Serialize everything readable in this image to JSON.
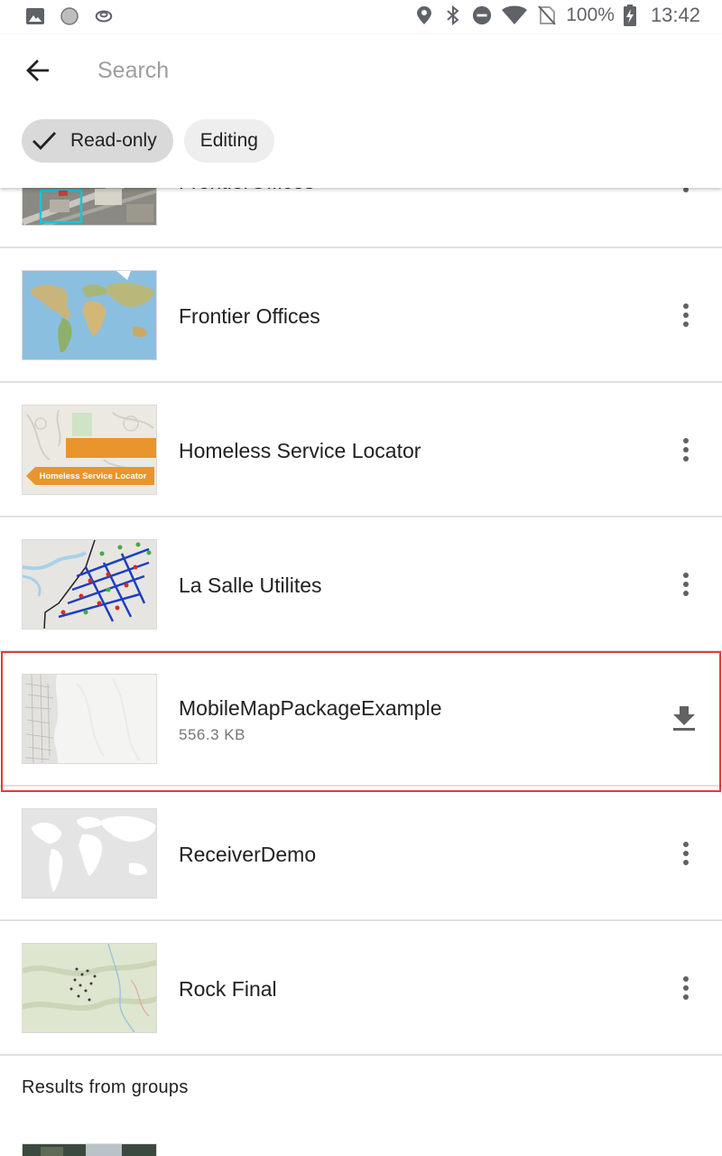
{
  "status_bar": {
    "left_icons": [
      "image-icon",
      "circle-icon",
      "sync-icon"
    ],
    "right_icons": [
      "location-icon",
      "bluetooth-icon",
      "do-not-disturb-icon",
      "wifi-icon",
      "no-sim-icon"
    ],
    "battery_text": "100%",
    "time": "13:42"
  },
  "header": {
    "search_placeholder": "Search",
    "search_value": "",
    "chips": [
      {
        "label": "Read-only",
        "selected": true
      },
      {
        "label": "Editing",
        "selected": false
      }
    ]
  },
  "items": [
    {
      "title": "FrontierOffices",
      "action": "more-vert-icon"
    },
    {
      "title": "Frontier Offices",
      "action": "more-vert-icon"
    },
    {
      "title": "Homeless Service Locator",
      "thumb_text": "Homeless Service Locator",
      "action": "more-vert-icon"
    },
    {
      "title": "La Salle Utilites",
      "action": "more-vert-icon"
    },
    {
      "title": "MobileMapPackageExample",
      "subtitle": "556.3 KB",
      "action": "download-icon",
      "highlighted": true
    },
    {
      "title": "ReceiverDemo",
      "action": "more-vert-icon"
    },
    {
      "title": "Rock Final",
      "action": "more-vert-icon"
    }
  ],
  "section": {
    "groups_header": "Results from groups"
  },
  "colors": {
    "highlight": "#e53935",
    "chip_selected": "#d9d9d9",
    "chip": "#eeeeee",
    "thumb_orange": "#e8952d"
  }
}
